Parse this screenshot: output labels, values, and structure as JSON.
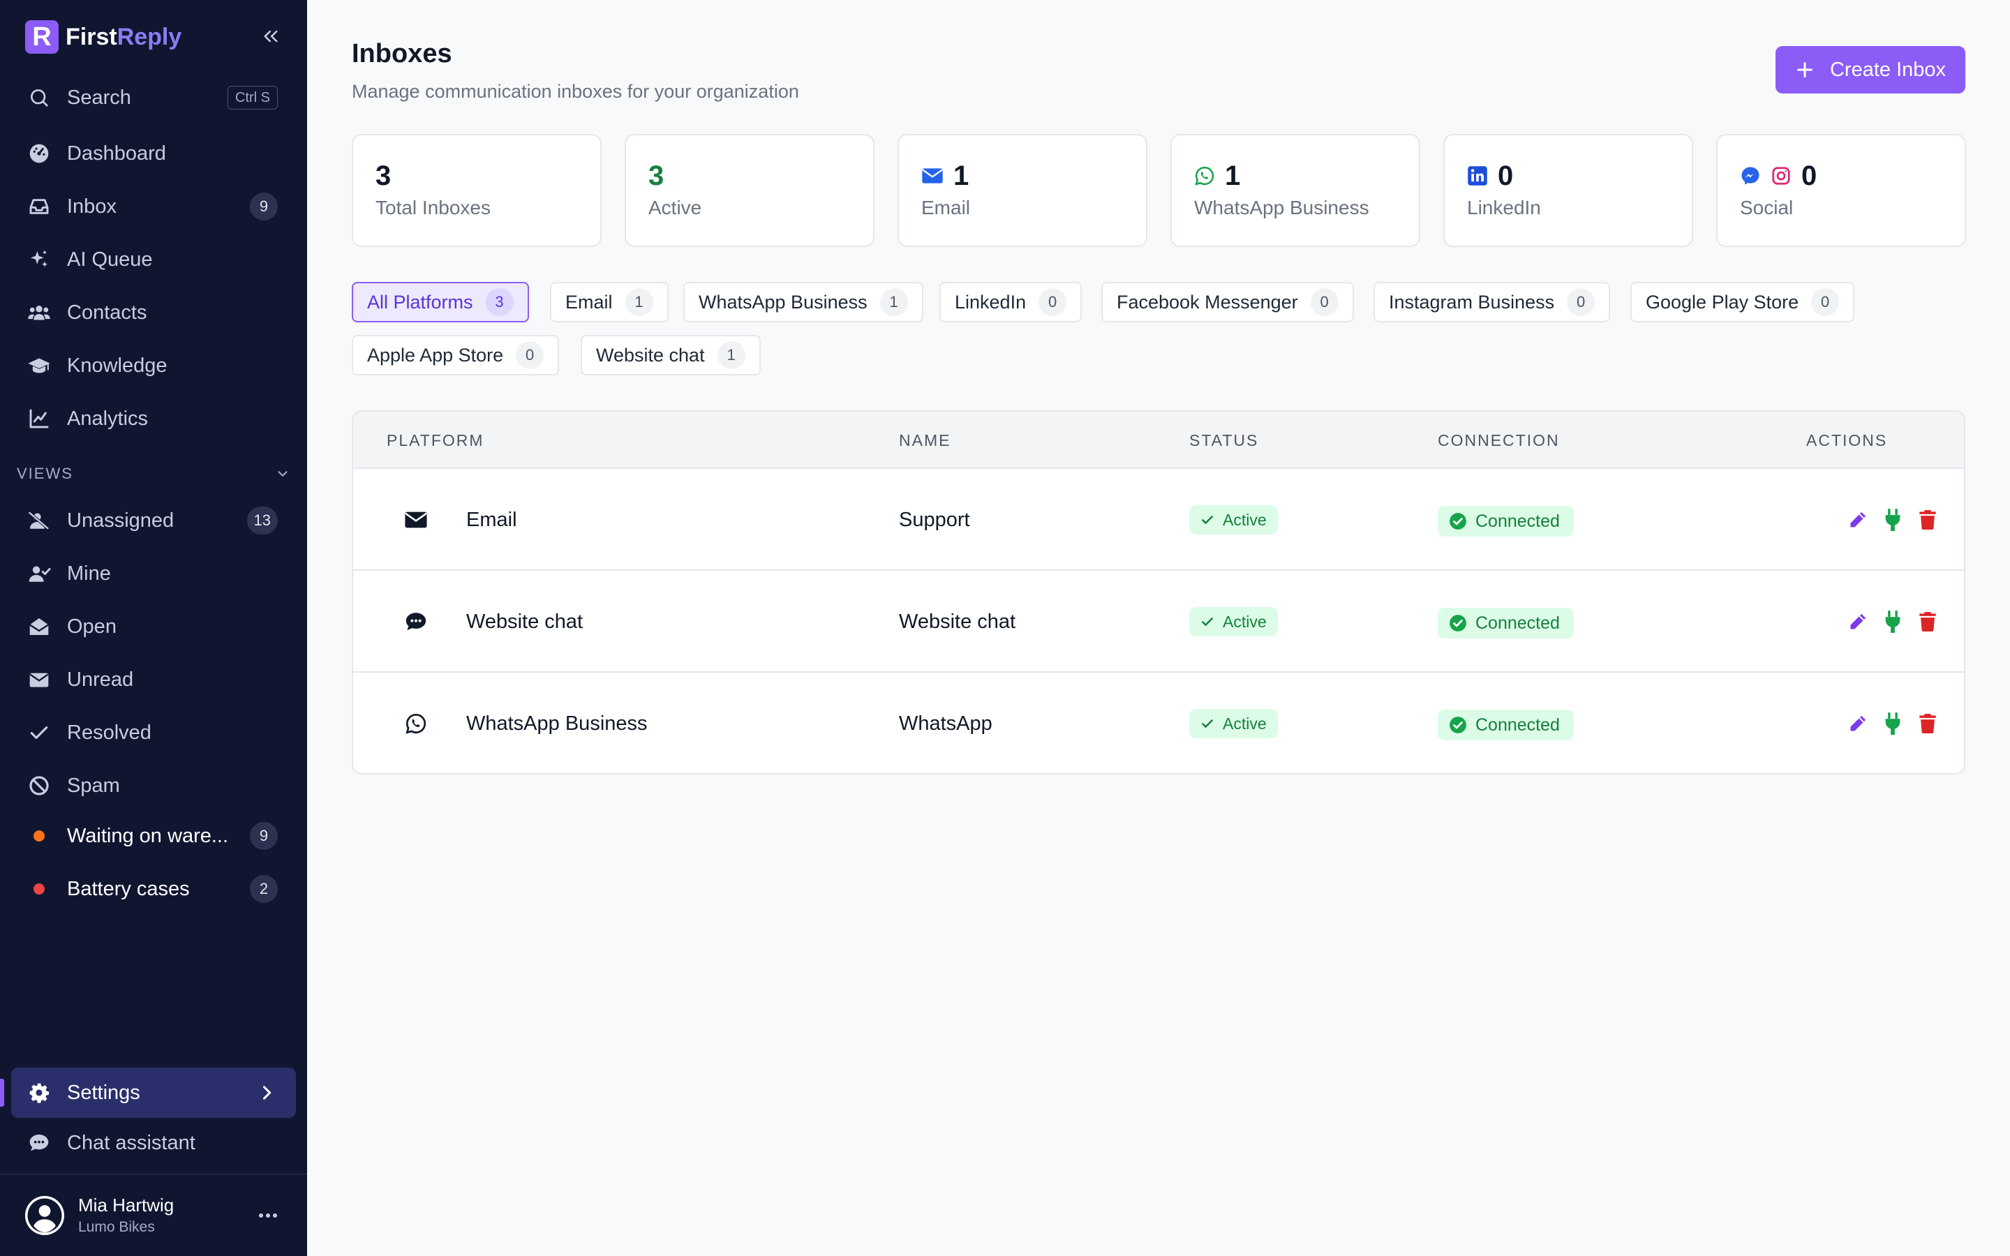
{
  "brand": {
    "logo_letter": "R",
    "name_part1": "First",
    "name_part2": "Reply",
    "accent": "#8b5cf6"
  },
  "sidebar": {
    "search": {
      "label": "Search",
      "shortcut": "Ctrl S"
    },
    "nav": [
      {
        "label": "Dashboard",
        "icon": "dashboard-icon"
      },
      {
        "label": "Inbox",
        "icon": "inbox-icon",
        "count": "9"
      },
      {
        "label": "AI Queue",
        "icon": "sparkles-icon"
      },
      {
        "label": "Contacts",
        "icon": "contacts-icon"
      },
      {
        "label": "Knowledge",
        "icon": "graduation-cap-icon"
      },
      {
        "label": "Analytics",
        "icon": "chart-line-icon"
      }
    ],
    "views_title": "VIEWS",
    "views": [
      {
        "label": "Unassigned",
        "icon": "user-slash-icon",
        "count": "13"
      },
      {
        "label": "Mine",
        "icon": "user-check-icon"
      },
      {
        "label": "Open",
        "icon": "envelope-open-icon"
      },
      {
        "label": "Unread",
        "icon": "envelope-icon"
      },
      {
        "label": "Resolved",
        "icon": "check-icon"
      },
      {
        "label": "Spam",
        "icon": "ban-icon"
      },
      {
        "label": "Waiting on ware...",
        "dot_color": "#f97316",
        "count": "9"
      },
      {
        "label": "Battery cases",
        "dot_color": "#ef4444",
        "count": "2"
      }
    ],
    "settings_label": "Settings",
    "chat_assistant_label": "Chat assistant",
    "user": {
      "name": "Mia Hartwig",
      "org": "Lumo Bikes"
    }
  },
  "header": {
    "title": "Inboxes",
    "subtitle": "Manage communication inboxes for your organization",
    "create_label": "Create Inbox"
  },
  "stats": [
    {
      "value": "3",
      "label": "Total Inboxes"
    },
    {
      "value": "3",
      "label": "Active"
    },
    {
      "value": "1",
      "label": "Email",
      "icon": "envelope-icon"
    },
    {
      "value": "1",
      "label": "WhatsApp Business",
      "icon": "whatsapp-icon"
    },
    {
      "value": "0",
      "label": "LinkedIn",
      "icon": "linkedin-icon"
    },
    {
      "value": "0",
      "label": "Social",
      "icon": "messenger-instagram-icon"
    }
  ],
  "filters": [
    {
      "label": "All Platforms",
      "count": "3"
    },
    {
      "label": "Email",
      "count": "1"
    },
    {
      "label": "WhatsApp Business",
      "count": "1"
    },
    {
      "label": "LinkedIn",
      "count": "0"
    },
    {
      "label": "Facebook Messenger",
      "count": "0"
    },
    {
      "label": "Instagram Business",
      "count": "0"
    },
    {
      "label": "Google Play Store",
      "count": "0"
    },
    {
      "label": "Apple App Store",
      "count": "0"
    },
    {
      "label": "Website chat",
      "count": "1"
    }
  ],
  "table": {
    "columns": [
      "PLATFORM",
      "NAME",
      "STATUS",
      "CONNECTION",
      "ACTIONS"
    ],
    "rows": [
      {
        "platform": "Email",
        "icon": "envelope-icon",
        "name": "Support",
        "status": "Active",
        "connection": "Connected"
      },
      {
        "platform": "Website chat",
        "icon": "chat-bubble-icon",
        "name": "Website chat",
        "status": "Active",
        "connection": "Connected"
      },
      {
        "platform": "WhatsApp Business",
        "icon": "whatsapp-icon",
        "name": "WhatsApp",
        "status": "Active",
        "connection": "Connected"
      }
    ]
  },
  "colors": {
    "sidebar_bg": "#111630",
    "accent": "#8b5cf6",
    "success": "#15803d",
    "danger": "#dc2626"
  }
}
